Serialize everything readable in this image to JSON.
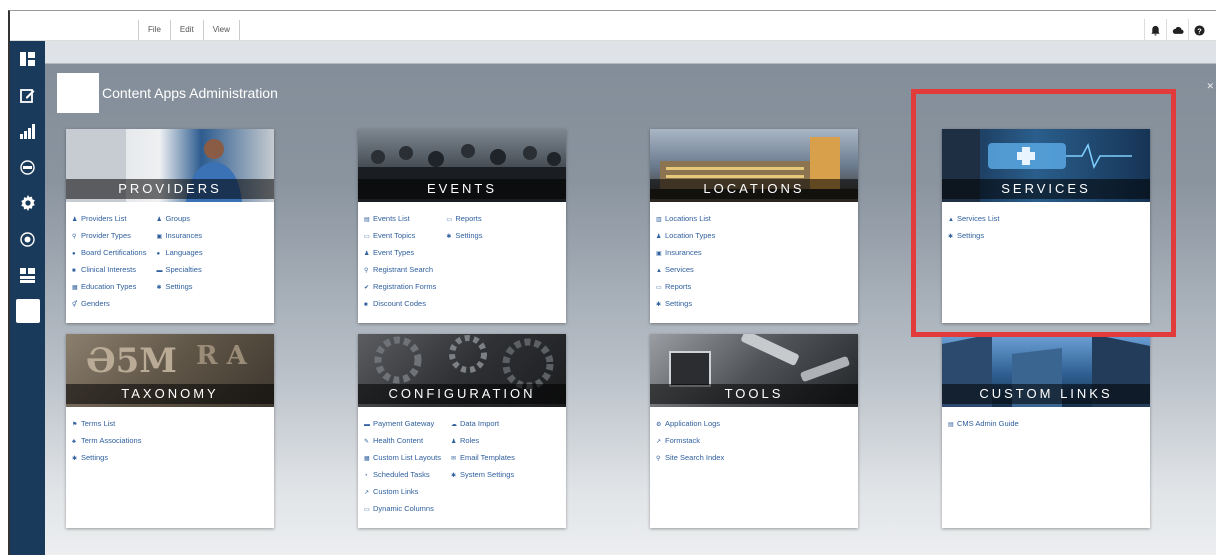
{
  "menu": [
    "File",
    "Edit",
    "View"
  ],
  "app_title": "Content Apps Administration",
  "sections": [
    {
      "title": "PROVIDERS",
      "columns": [
        [
          "Providers List",
          "Provider Types",
          "Board Certifications",
          "Clinical Interests",
          "Education Types",
          "Genders"
        ],
        [
          "Groups",
          "Insurances",
          "Languages",
          "Specialties",
          "Settings"
        ]
      ]
    },
    {
      "title": "EVENTS",
      "columns": [
        [
          "Events List",
          "Event Topics",
          "Event Types",
          "Registrant Search",
          "Registration Forms",
          "Discount Codes"
        ],
        [
          "Reports",
          "Settings"
        ]
      ]
    },
    {
      "title": "LOCATIONS",
      "columns": [
        [
          "Locations List",
          "Location Types",
          "Insurances",
          "Services",
          "Reports",
          "Settings"
        ]
      ]
    },
    {
      "title": "SERVICES",
      "columns": [
        [
          "Services List",
          "Settings"
        ]
      ]
    },
    {
      "title": "TAXONOMY",
      "columns": [
        [
          "Terms List",
          "Term Associations",
          "Settings"
        ]
      ]
    },
    {
      "title": "CONFIGURATION",
      "columns": [
        [
          "Payment Gateway",
          "Health Content",
          "Custom List Layouts",
          "Scheduled Tasks",
          "Custom Links",
          "Dynamic Columns"
        ],
        [
          "Data Import",
          "Roles",
          "Email Templates",
          "System Settings"
        ]
      ]
    },
    {
      "title": "TOOLS",
      "columns": [
        [
          "Application Logs",
          "Formstack",
          "Site Search Index"
        ]
      ]
    },
    {
      "title": "CUSTOM LINKS",
      "columns": [
        [
          "CMS Admin Guide"
        ]
      ]
    }
  ]
}
